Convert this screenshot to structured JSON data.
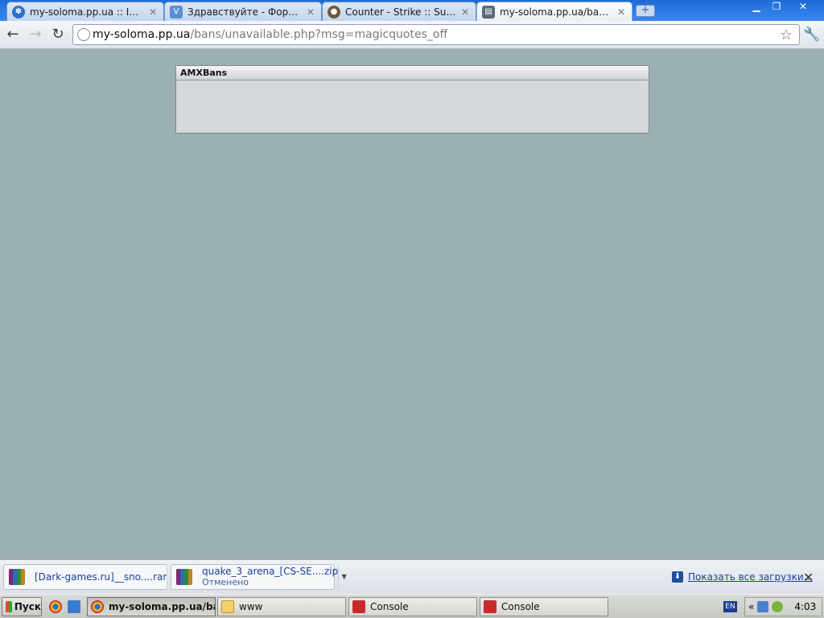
{
  "browser": {
    "tabs": [
      {
        "label": "my-soloma.pp.ua :: ISPma...",
        "active": false,
        "icon": "ispmanager-icon"
      },
      {
        "label": "Здравствуйте - Форум са...",
        "active": false,
        "icon": "forum-icon"
      },
      {
        "label": "Counter - Strike :: Support ...",
        "active": false,
        "icon": "counter-strike-icon"
      },
      {
        "label": "my-soloma.pp.ua/bans/un...",
        "active": true,
        "icon": "page-icon"
      }
    ],
    "new_tab_label": "+",
    "window_controls": {
      "minimize": "▁",
      "restore": "❐",
      "close": "✕"
    },
    "address": {
      "host": "my-soloma.pp.ua",
      "path": "/bans/unavailable.php?msg=magicquotes_off"
    }
  },
  "page": {
    "panel_title": "AMXBans",
    "bg_color": "#9bb0b1"
  },
  "downloads": {
    "items": [
      {
        "name": "[Dark-games.ru]__sno....rar",
        "status": ""
      },
      {
        "name": "quake_3_arena_[CS-SE....zip",
        "status": "Отменено"
      }
    ],
    "show_all": "Показать все загрузки..."
  },
  "taskbar": {
    "start_label": "Пуск",
    "windows": [
      {
        "label": "my-soloma.pp.ua/ba...",
        "active": true
      },
      {
        "label": "www",
        "active": false
      },
      {
        "label": "Console",
        "active": false
      },
      {
        "label": "Console",
        "active": false
      }
    ],
    "lang": "EN",
    "clock": "4:03"
  }
}
